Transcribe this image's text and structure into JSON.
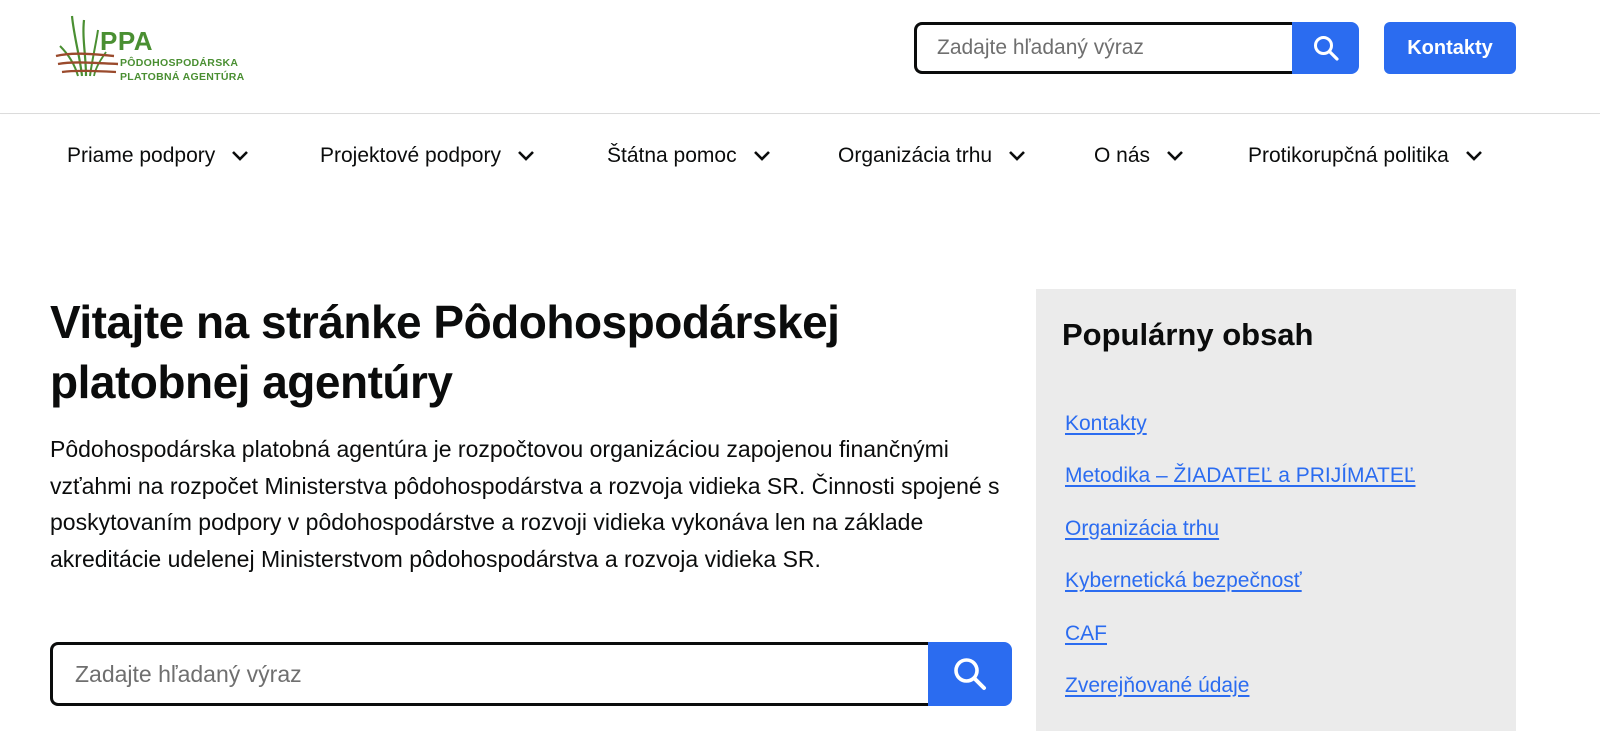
{
  "header": {
    "logo": {
      "abbr": "PPA",
      "line1": "PÔDOHOSPODÁRSKA",
      "line2": "PLATOBNÁ AGENTÚRA",
      "icon": "grass-logo-icon"
    },
    "search": {
      "placeholder": "Zadajte hľadaný výraz",
      "value": "",
      "icon": "search-icon"
    },
    "contact_label": "Kontakty"
  },
  "nav": {
    "items": [
      {
        "label": "Priame podpory",
        "icon": "chevron-down-icon"
      },
      {
        "label": "Projektové podpory",
        "icon": "chevron-down-icon"
      },
      {
        "label": "Štátna pomoc",
        "icon": "chevron-down-icon"
      },
      {
        "label": "Organizácia trhu",
        "icon": "chevron-down-icon"
      },
      {
        "label": "O nás",
        "icon": "chevron-down-icon"
      },
      {
        "label": "Protikorupčná politika",
        "icon": "chevron-down-icon"
      }
    ]
  },
  "hero": {
    "title": "Vitajte na stránke Pôdohospodárskej platobnej agentúry",
    "text": "Pôdohospodárska platobná agentúra je rozpočtovou organizáciou zapojenou finančnými vzťahmi na rozpočet Ministerstva pôdohospodárstva a rozvoja vidieka SR. Činnosti spojené s poskytovaním podpory v pôdohospodárstve a rozvoji vidieka vykonáva len na základe akreditácie udelenej Ministerstvom pôdohospodárstva a rozvoja vidieka SR.",
    "search": {
      "placeholder": "Zadajte hľadaný výraz",
      "value": "",
      "icon": "search-icon"
    }
  },
  "popular": {
    "title": "Populárny obsah",
    "links": [
      {
        "label": "Kontakty"
      },
      {
        "label": "Metodika – ŽIADATEĽ a PRIJÍMATEĽ"
      },
      {
        "label": "Organizácia trhu"
      },
      {
        "label": "Kybernetická bezpečnosť"
      },
      {
        "label": "CAF"
      },
      {
        "label": "Zverejňované údaje"
      }
    ]
  },
  "colors": {
    "accent": "#2b6cf0",
    "brand_green": "#4a8f32",
    "brand_brown": "#9a4a2c",
    "panel_bg": "#ebebeb",
    "text": "#0b0c0c"
  }
}
